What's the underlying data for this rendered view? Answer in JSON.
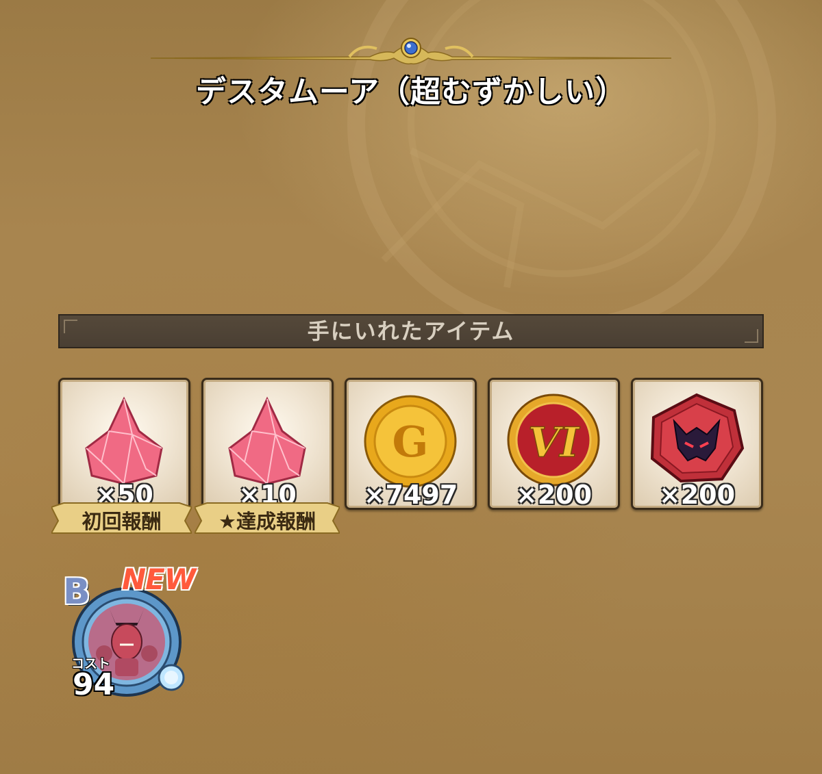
{
  "title": "デスタムーア（超むずかしい）",
  "section_header": "手にいれたアイテム",
  "items": [
    {
      "icon": "pink-gem-icon",
      "quantity": "×50",
      "ribbon": "初回報酬"
    },
    {
      "icon": "pink-gem-icon",
      "quantity": "×10",
      "ribbon": "★達成報酬"
    },
    {
      "icon": "gold-coin-icon",
      "quantity": "×7497"
    },
    {
      "icon": "vi-medal-icon",
      "quantity": "×200"
    },
    {
      "icon": "demon-crest-icon",
      "quantity": "×200"
    }
  ],
  "monster": {
    "rank": "B",
    "badge": "NEW",
    "cost_label": "コスト",
    "cost": "94"
  },
  "colors": {
    "gem": "#f0607a",
    "coin": "#e8a81c",
    "medal_red": "#b8202a",
    "crest_red": "#c0303a",
    "new": "#ff5a3c"
  }
}
